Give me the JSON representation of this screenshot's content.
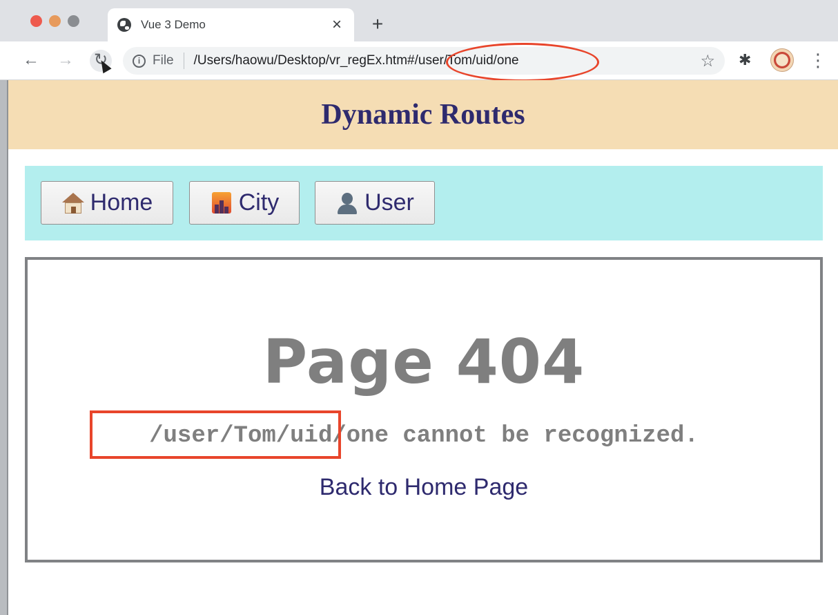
{
  "browser": {
    "tab_title": "Vue 3 Demo",
    "tab_close": "×",
    "new_tab": "+",
    "nav_back": "←",
    "nav_forward": "→",
    "nav_reload": "↻",
    "scheme_label": "File",
    "url_path": "/Users/haowu/Desktop/vr_regEx.htm",
    "url_hash": "#/user/Tom/uid/one",
    "bookmark_star": "☆",
    "extensions_glyph": "✱",
    "menu_glyph": "⋮",
    "info_glyph": "i"
  },
  "header": {
    "title": "Dynamic Routes"
  },
  "nav": {
    "items": [
      {
        "label": "Home",
        "icon": "house-icon"
      },
      {
        "label": "City",
        "icon": "city-icon"
      },
      {
        "label": "User",
        "icon": "user-icon"
      }
    ]
  },
  "main": {
    "heading": "Page 404",
    "message": "/user/Tom/uid/one cannot be recognized.",
    "back_link": "Back to Home Page"
  },
  "colors": {
    "header_bg": "#f5ddb4",
    "nav_bg": "#b3eeee",
    "title_text": "#2e2a6e",
    "error_gray": "#7f7f7f",
    "annotation_red": "#e8452b"
  }
}
